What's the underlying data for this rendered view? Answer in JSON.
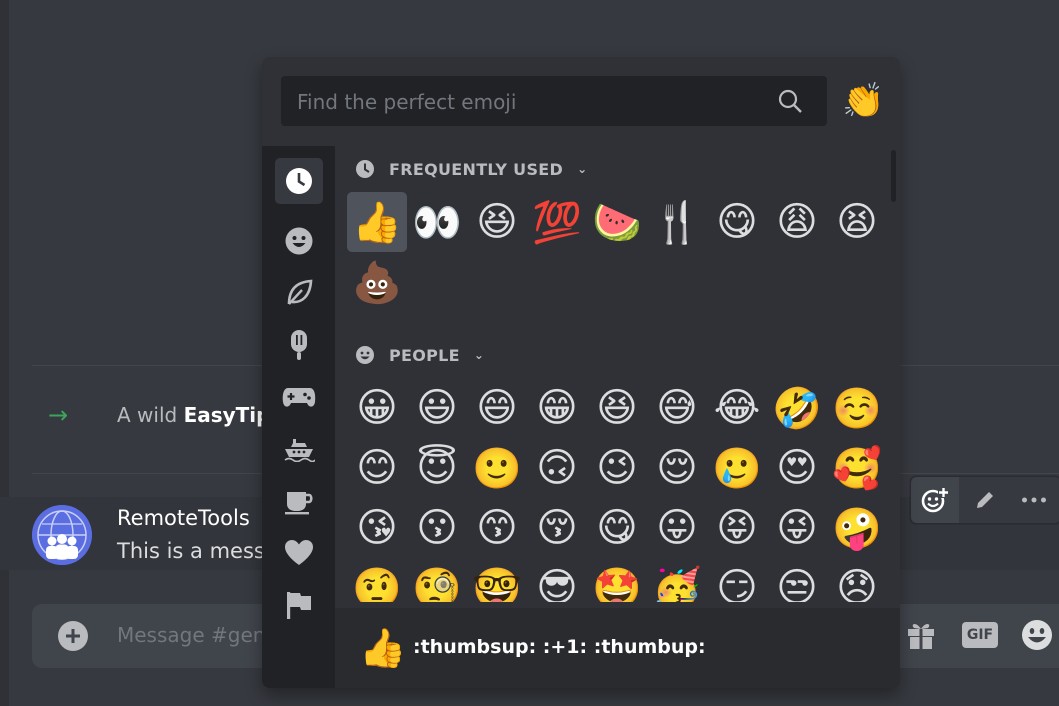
{
  "system_message": {
    "prefix": "A wild ",
    "name": "EasyTip"
  },
  "message": {
    "author": "RemoteTools",
    "text": "This is a messa"
  },
  "composer": {
    "placeholder": "Message #gen",
    "gif_label": "GIF"
  },
  "picker": {
    "search_placeholder": "Find the perfect emoji",
    "random_emoji": "👏",
    "sections": [
      {
        "title": "FREQUENTLY USED",
        "emojis": [
          "👍",
          "👀",
          "😆",
          "💯",
          "🍉",
          "🍴",
          "😋",
          "😩",
          "😫",
          "💩"
        ]
      },
      {
        "title": "PEOPLE",
        "emojis": [
          "😀",
          "😃",
          "😄",
          "😁",
          "😆",
          "😅",
          "😂",
          "🤣",
          "☺️",
          "😊",
          "😇",
          "🙂",
          "🙃",
          "😉",
          "😌",
          "🥲",
          "😍",
          "🥰",
          "😘",
          "😗",
          "😙",
          "😚",
          "😋",
          "😛",
          "😝",
          "😜",
          "🤪",
          "🤨",
          "🧐",
          "🤓",
          "😎",
          "🤩",
          "🥳",
          "😏",
          "😒",
          "😞"
        ]
      }
    ],
    "preview": {
      "emoji": "👍",
      "name": ":thumbsup: :+1: :thumbup:"
    }
  }
}
